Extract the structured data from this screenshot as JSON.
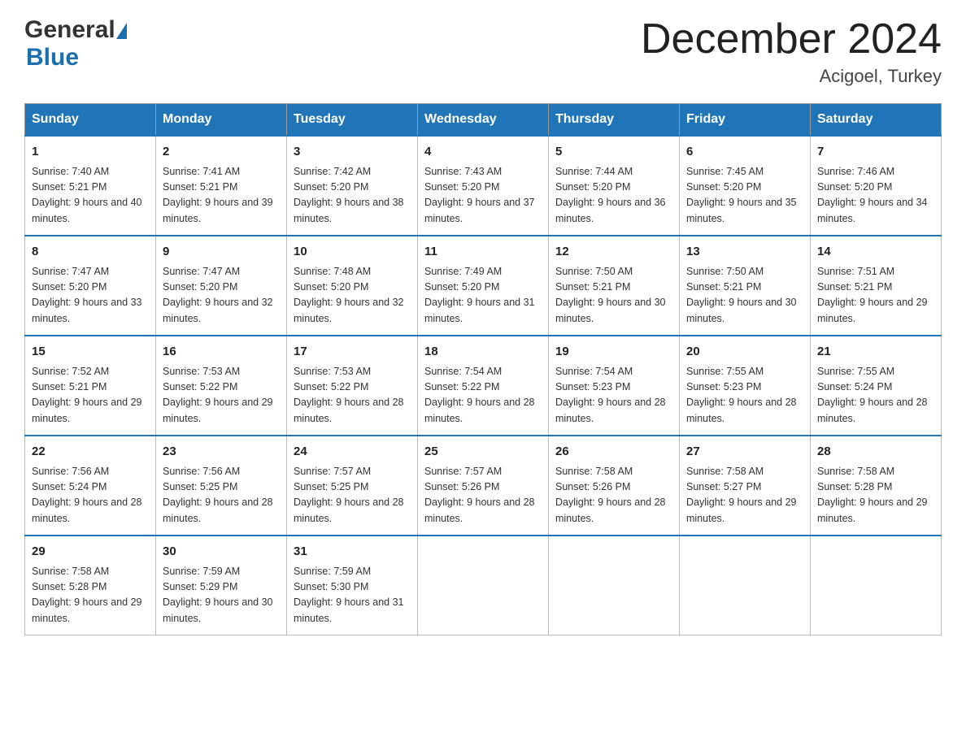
{
  "header": {
    "logo_general": "General",
    "logo_blue": "Blue",
    "month_title": "December 2024",
    "location": "Acigoel, Turkey"
  },
  "days_of_week": [
    "Sunday",
    "Monday",
    "Tuesday",
    "Wednesday",
    "Thursday",
    "Friday",
    "Saturday"
  ],
  "weeks": [
    [
      {
        "day": "1",
        "sunrise": "7:40 AM",
        "sunset": "5:21 PM",
        "daylight": "9 hours and 40 minutes."
      },
      {
        "day": "2",
        "sunrise": "7:41 AM",
        "sunset": "5:21 PM",
        "daylight": "9 hours and 39 minutes."
      },
      {
        "day": "3",
        "sunrise": "7:42 AM",
        "sunset": "5:20 PM",
        "daylight": "9 hours and 38 minutes."
      },
      {
        "day": "4",
        "sunrise": "7:43 AM",
        "sunset": "5:20 PM",
        "daylight": "9 hours and 37 minutes."
      },
      {
        "day": "5",
        "sunrise": "7:44 AM",
        "sunset": "5:20 PM",
        "daylight": "9 hours and 36 minutes."
      },
      {
        "day": "6",
        "sunrise": "7:45 AM",
        "sunset": "5:20 PM",
        "daylight": "9 hours and 35 minutes."
      },
      {
        "day": "7",
        "sunrise": "7:46 AM",
        "sunset": "5:20 PM",
        "daylight": "9 hours and 34 minutes."
      }
    ],
    [
      {
        "day": "8",
        "sunrise": "7:47 AM",
        "sunset": "5:20 PM",
        "daylight": "9 hours and 33 minutes."
      },
      {
        "day": "9",
        "sunrise": "7:47 AM",
        "sunset": "5:20 PM",
        "daylight": "9 hours and 32 minutes."
      },
      {
        "day": "10",
        "sunrise": "7:48 AM",
        "sunset": "5:20 PM",
        "daylight": "9 hours and 32 minutes."
      },
      {
        "day": "11",
        "sunrise": "7:49 AM",
        "sunset": "5:20 PM",
        "daylight": "9 hours and 31 minutes."
      },
      {
        "day": "12",
        "sunrise": "7:50 AM",
        "sunset": "5:21 PM",
        "daylight": "9 hours and 30 minutes."
      },
      {
        "day": "13",
        "sunrise": "7:50 AM",
        "sunset": "5:21 PM",
        "daylight": "9 hours and 30 minutes."
      },
      {
        "day": "14",
        "sunrise": "7:51 AM",
        "sunset": "5:21 PM",
        "daylight": "9 hours and 29 minutes."
      }
    ],
    [
      {
        "day": "15",
        "sunrise": "7:52 AM",
        "sunset": "5:21 PM",
        "daylight": "9 hours and 29 minutes."
      },
      {
        "day": "16",
        "sunrise": "7:53 AM",
        "sunset": "5:22 PM",
        "daylight": "9 hours and 29 minutes."
      },
      {
        "day": "17",
        "sunrise": "7:53 AM",
        "sunset": "5:22 PM",
        "daylight": "9 hours and 28 minutes."
      },
      {
        "day": "18",
        "sunrise": "7:54 AM",
        "sunset": "5:22 PM",
        "daylight": "9 hours and 28 minutes."
      },
      {
        "day": "19",
        "sunrise": "7:54 AM",
        "sunset": "5:23 PM",
        "daylight": "9 hours and 28 minutes."
      },
      {
        "day": "20",
        "sunrise": "7:55 AM",
        "sunset": "5:23 PM",
        "daylight": "9 hours and 28 minutes."
      },
      {
        "day": "21",
        "sunrise": "7:55 AM",
        "sunset": "5:24 PM",
        "daylight": "9 hours and 28 minutes."
      }
    ],
    [
      {
        "day": "22",
        "sunrise": "7:56 AM",
        "sunset": "5:24 PM",
        "daylight": "9 hours and 28 minutes."
      },
      {
        "day": "23",
        "sunrise": "7:56 AM",
        "sunset": "5:25 PM",
        "daylight": "9 hours and 28 minutes."
      },
      {
        "day": "24",
        "sunrise": "7:57 AM",
        "sunset": "5:25 PM",
        "daylight": "9 hours and 28 minutes."
      },
      {
        "day": "25",
        "sunrise": "7:57 AM",
        "sunset": "5:26 PM",
        "daylight": "9 hours and 28 minutes."
      },
      {
        "day": "26",
        "sunrise": "7:58 AM",
        "sunset": "5:26 PM",
        "daylight": "9 hours and 28 minutes."
      },
      {
        "day": "27",
        "sunrise": "7:58 AM",
        "sunset": "5:27 PM",
        "daylight": "9 hours and 29 minutes."
      },
      {
        "day": "28",
        "sunrise": "7:58 AM",
        "sunset": "5:28 PM",
        "daylight": "9 hours and 29 minutes."
      }
    ],
    [
      {
        "day": "29",
        "sunrise": "7:58 AM",
        "sunset": "5:28 PM",
        "daylight": "9 hours and 29 minutes."
      },
      {
        "day": "30",
        "sunrise": "7:59 AM",
        "sunset": "5:29 PM",
        "daylight": "9 hours and 30 minutes."
      },
      {
        "day": "31",
        "sunrise": "7:59 AM",
        "sunset": "5:30 PM",
        "daylight": "9 hours and 31 minutes."
      },
      null,
      null,
      null,
      null
    ]
  ],
  "labels": {
    "sunrise": "Sunrise: ",
    "sunset": "Sunset: ",
    "daylight": "Daylight: "
  }
}
